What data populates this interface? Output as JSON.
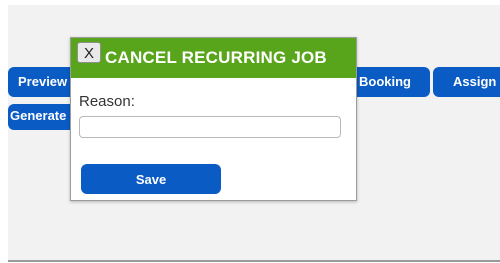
{
  "background_buttons": {
    "preview_label": "Preview C",
    "booking_label": "Booking",
    "assign_label": "Assign",
    "generate_label": "Generate I"
  },
  "modal": {
    "title": "CANCEL RECURRING JOB",
    "close_label": "X",
    "reason_label": "Reason:",
    "reason_value": "",
    "save_label": "Save"
  },
  "colors": {
    "header_green": "#58a51c",
    "button_blue": "#0a5bc4",
    "page_gray": "#f2f2f2"
  }
}
